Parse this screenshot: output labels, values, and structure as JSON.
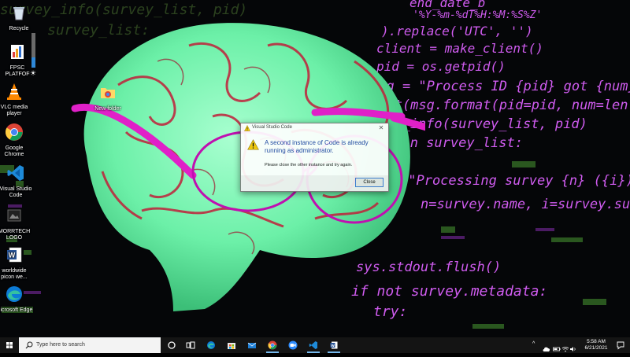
{
  "wallpaper": {
    "code_lines": [
      {
        "text": "'%Y-%m-%dT%H:%M:%S%Z'",
        "color": "#d05cf0"
      },
      {
        "text": ").replace('UTC', '')",
        "color": "#d05cf0"
      },
      {
        "text": "client = make_client()",
        "color": "#d05cf0"
      },
      {
        "text": "pid = os.getpid()",
        "color": "#d05cf0"
      },
      {
        "text": "msg = \"Process ID {pid} got {num} surve",
        "color": "#d05cf0"
      },
      {
        "text": "rint(msg.format(pid=pid, num=len(surve",
        "color": "#d05cf0"
      },
      {
        "text": "ey_info(survey_list, pid)",
        "color": "#d05cf0"
      },
      {
        "text": "y in survey_list:",
        "color": "#d05cf0"
      },
      {
        "text": "(\"Processing survey {n} ({i})...\"",
        "color": "#d05cf0"
      },
      {
        "text": "n=survey.name, i=survey.surv",
        "color": "#d05cf0"
      },
      {
        "text": "sys.stdout.flush()",
        "color": "#d05cf0"
      },
      {
        "text": "if not survey.metadata:",
        "color": "#d05cf0"
      },
      {
        "text": "try:",
        "color": "#d05cf0"
      },
      {
        "text": "survey_info(survey_list, pid)",
        "color": "#5a8a3a"
      },
      {
        "text": "survey_list:",
        "color": "#5a8a3a"
      },
      {
        "text": "end_date_b",
        "color": "#d05cf0"
      }
    ]
  },
  "desktop_icons": [
    {
      "name": "recycle-bin",
      "label": "Recycle",
      "icon": "recycle-bin-icon"
    },
    {
      "name": "fpsc-platform",
      "label": "FPSC PLATFOF",
      "icon": "bar-chart-icon"
    },
    {
      "name": "vlc-media-player",
      "label": "VLC media player",
      "icon": "vlc-cone-icon"
    },
    {
      "name": "google-chrome",
      "label": "Google Chrome",
      "icon": "chrome-icon"
    },
    {
      "name": "visual-studio-code",
      "label": "Visual Studio Code",
      "icon": "vscode-icon"
    },
    {
      "name": "morrtech-logo",
      "label": "MORRTECH LOGO",
      "icon": "image-icon"
    },
    {
      "name": "worldwide-picon",
      "label": "worldwide picon we...",
      "icon": "word-icon"
    },
    {
      "name": "microsoft-edge",
      "label": "Microsoft Edge",
      "icon": "edge-icon"
    },
    {
      "name": "new-folder",
      "label": "New folder",
      "icon": "folder-icon"
    }
  ],
  "brightness": {
    "level_percent": 30,
    "icon": "sun-icon"
  },
  "dialog": {
    "title": "Visual Studio Code",
    "message": "A second instance of Code is already running as administrator.",
    "detail": "Please close the other instance and try again.",
    "button_label": "Close",
    "close_glyph": "✕"
  },
  "taskbar": {
    "search_placeholder": "Type here to search",
    "pinned": [
      "cortana-icon",
      "task-view-icon",
      "edge-icon",
      "store-icon",
      "mail-icon",
      "chrome-icon",
      "zoom-icon",
      "vscode-icon",
      "word-icon"
    ],
    "clock_time": "5:58 AM",
    "clock_date": "6/21/2021",
    "tray_chevron": "^"
  },
  "colors": {
    "taskbar_bg": "#141414",
    "accent": "#2f88d8",
    "brain_green": "#6cf0a8",
    "glasses_magenta": "#e020c8"
  }
}
